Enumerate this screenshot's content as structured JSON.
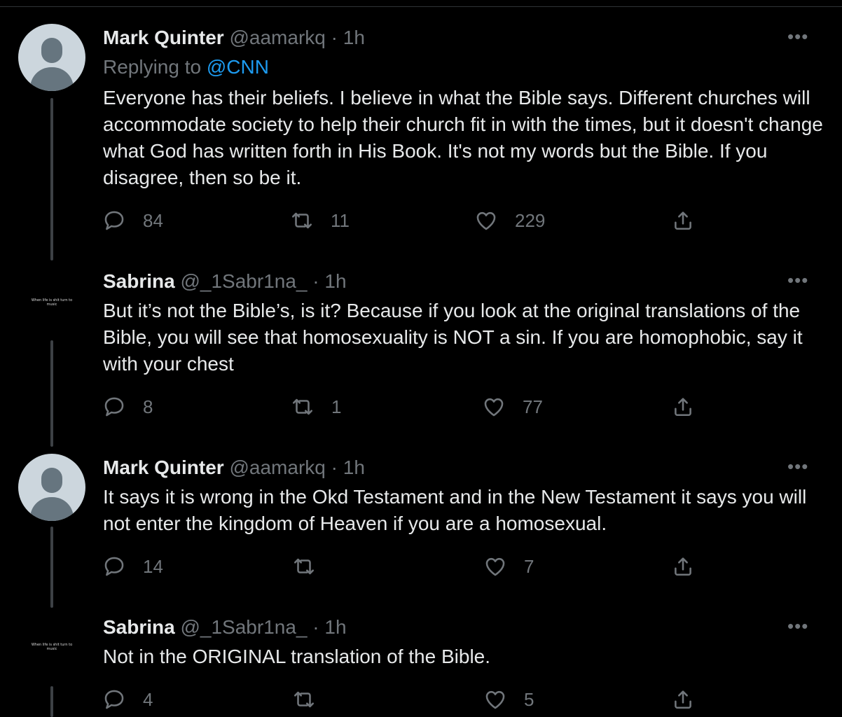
{
  "tweets": [
    {
      "name": "Mark Quinter",
      "handle": "@aamarkq",
      "separator": "·",
      "time": "1h",
      "replying_prefix": "Replying to ",
      "replying_handle": "@CNN",
      "text": "Everyone has their beliefs. I believe in what the Bible says. Different churches will accommodate society to help their church fit in with the times, but it doesn't change what God has written forth in His Book. It's not my words but the Bible. If you disagree, then so be it.",
      "reply_count": "84",
      "retweet_count": "11",
      "like_count": "229",
      "more": "•••",
      "avatar": "default-profile-avatar"
    },
    {
      "name": "Sabrina",
      "handle": "@_1Sabr1na_",
      "separator": "·",
      "time": "1h",
      "text": "But it’s not the Bible’s, is it? Because if you look at the original translations of the Bible, you will see that homosexuality is NOT a sin. If you are homophobic, say it with your chest",
      "reply_count": "8",
      "retweet_count": "1",
      "like_count": "77",
      "more": "•••",
      "avatar_text": "When life is shit turn to music"
    },
    {
      "name": "Mark Quinter",
      "handle": "@aamarkq",
      "separator": "·",
      "time": "1h",
      "text": "It says it is wrong in the Okd Testament and in the New Testament it says you will not enter the kingdom of Heaven if you are a homosexual.",
      "reply_count": "14",
      "retweet_count": "",
      "like_count": "7",
      "more": "•••",
      "avatar": "default-profile-avatar"
    },
    {
      "name": "Sabrina",
      "handle": "@_1Sabr1na_",
      "separator": "·",
      "time": "1h",
      "text": "Not in the ORIGINAL translation of the Bible.",
      "reply_count": "4",
      "retweet_count": "",
      "like_count": "5",
      "more": "•••",
      "avatar_text": "When life is shit turn to music"
    }
  ],
  "colors": {
    "background": "#000000",
    "text": "#e7e9ea",
    "muted": "#71767b",
    "link": "#1d9bf0"
  }
}
